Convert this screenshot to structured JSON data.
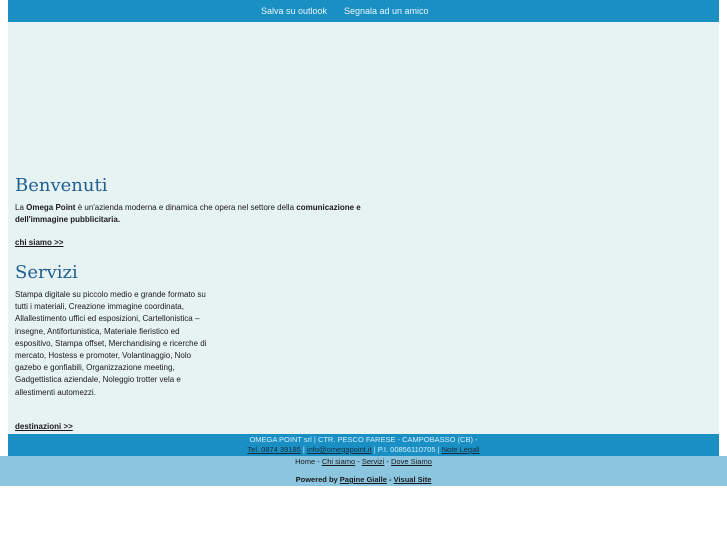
{
  "topbar": {
    "save_outlook": "Salva su outlook",
    "report_friend": "Segnala ad un amico"
  },
  "welcome": {
    "title": "Benvenuti",
    "text_1": "La ",
    "company": "Omega Point",
    "text_2": " è un'azienda moderna e dinamica che opera nel settore della ",
    "sector": "comunicazione e dell'immagine pubblicitaria.",
    "more_link": "chi siamo >>"
  },
  "services": {
    "title": "Servizi",
    "lines": [
      "Stampa digitale su piccolo medio e grande formato su",
      "tutti i materiali, Creazione immagine coordinata,",
      "Allallestimento uffici ed esposizioni, Cartellonistica –",
      "insegne, Antifortunistica, Materiale fieristico ed",
      "espositivo, Stampa offset, Merchandising e ricerche di",
      "mercato, Hostess e promoter, Volantinaggio, Nolo",
      "gazebo e gonfiabili, Organizzazione meeting,",
      "Gadgettistica aziendale, Noleggio trotter vela e",
      "allestimenti automezzi."
    ],
    "more_link": "destinazioni >>"
  },
  "footer": {
    "address": "OMEGA POINT srl | CTR. PESCO FARESE - CAMPOBASSO (CB) -",
    "phone": "Tel. 0874 39185",
    "sep1": " | ",
    "email": "info@omegapoint.it",
    "piva": " | P.I. 00856110705 | ",
    "legal": "Note Legali"
  },
  "footer_nav": {
    "home": "Home",
    "sep": " - ",
    "about": "Chi siamo",
    "services": "Servizi",
    "location": "Dove Siamo"
  },
  "powered": {
    "label": "Powered by ",
    "pagine": "Pagine Gialle",
    "sep": " - ",
    "visual": "Visual Site"
  }
}
